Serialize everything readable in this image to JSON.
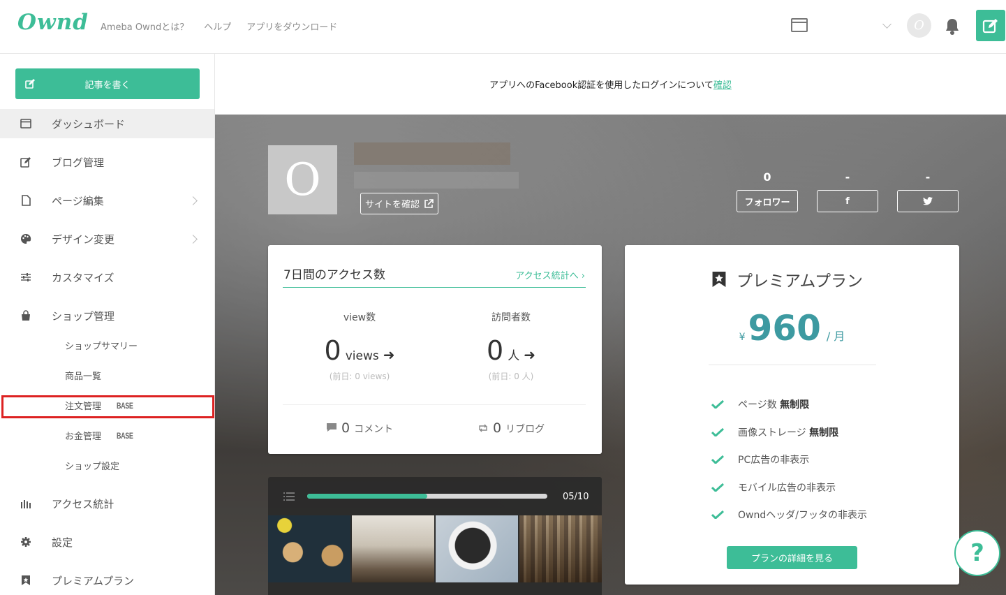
{
  "header": {
    "logo": "Ownd",
    "nav": [
      "Ameba Owndとは？",
      "ヘルプ",
      "アプリをダウンロード"
    ],
    "avatar_letter": "O"
  },
  "notice": {
    "text": "アプリへのFacebook認証を使用したログインについて",
    "link": "確認"
  },
  "sidebar": {
    "write_button": "記事を書く",
    "items": [
      {
        "label": "ダッシュボード",
        "icon": "browser-icon"
      },
      {
        "label": "ブログ管理",
        "icon": "edit-icon"
      },
      {
        "label": "ページ編集",
        "icon": "page-icon"
      },
      {
        "label": "デザイン変更",
        "icon": "palette-icon"
      },
      {
        "label": "カスタマイズ",
        "icon": "sliders-icon"
      },
      {
        "label": "ショップ管理",
        "icon": "shop-icon"
      },
      {
        "label": "アクセス統計",
        "icon": "bar-chart-icon"
      },
      {
        "label": "設定",
        "icon": "gear-icon"
      },
      {
        "label": "プレミアムプラン",
        "icon": "star-badge-icon"
      }
    ],
    "shop_sub": [
      "ショップサマリー",
      "商品一覧",
      "注文管理",
      "お金管理",
      "ショップ設定"
    ],
    "base_badge": "BASE"
  },
  "site": {
    "thumb_letter": "O",
    "check_button": "サイトを確認",
    "stats": [
      {
        "value": "0",
        "button": "フォロワー"
      },
      {
        "value": "-",
        "button": "f"
      },
      {
        "value": "-",
        "button": "twitter-icon"
      }
    ]
  },
  "access": {
    "title": "7日間のアクセス数",
    "link": "アクセス統計へ",
    "views": {
      "label": "view数",
      "value": "0",
      "unit": "views",
      "prev": "(前日: 0 views)"
    },
    "visitors": {
      "label": "訪問者数",
      "value": "0",
      "unit": "人",
      "prev": "(前日: 0 人)"
    },
    "comments": {
      "value": "0",
      "label": "コメント"
    },
    "reblogs": {
      "value": "0",
      "label": "リブログ"
    }
  },
  "premium": {
    "title": "プレミアムプラン",
    "currency": "¥",
    "price": "960",
    "period": "/ 月",
    "features": [
      {
        "text": "ページ数 ",
        "bold": "無制限"
      },
      {
        "text": "画像ストレージ ",
        "bold": "無制限"
      },
      {
        "text": "PC広告の非表示",
        "bold": ""
      },
      {
        "text": "モバイル広告の非表示",
        "bold": ""
      },
      {
        "text": "Owndヘッダ/フッタの非表示",
        "bold": ""
      }
    ],
    "button": "プランの詳細を見る"
  },
  "themes": {
    "counter": "05/10",
    "progress": 0.5
  },
  "help": {
    "label": "?"
  },
  "colors": {
    "accent": "#3dbd97",
    "price": "#3d9aa1",
    "highlight": "#dd2222"
  }
}
